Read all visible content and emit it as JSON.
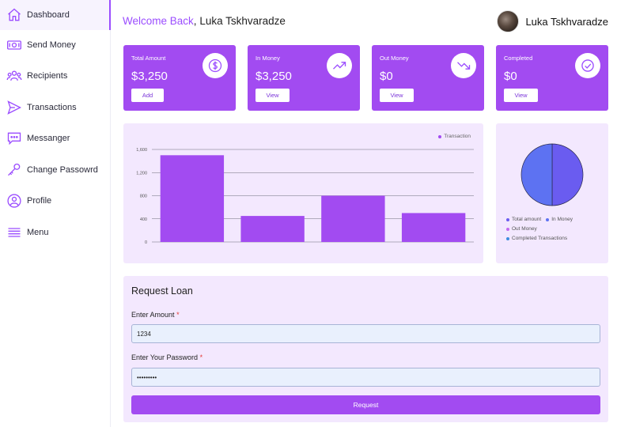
{
  "sidebar": {
    "items": [
      {
        "label": "Dashboard",
        "icon": "home-icon"
      },
      {
        "label": "Send Money",
        "icon": "money-icon"
      },
      {
        "label": "Recipients",
        "icon": "users-icon"
      },
      {
        "label": "Transactions",
        "icon": "send-icon"
      },
      {
        "label": "Messanger",
        "icon": "chat-icon"
      },
      {
        "label": "Change Passowrd",
        "icon": "key-icon"
      },
      {
        "label": "Profile",
        "icon": "profile-icon"
      },
      {
        "label": "Menu",
        "icon": "menu-icon"
      }
    ]
  },
  "header": {
    "welcome": "Welcome Back",
    "comma": ",",
    "user_name": "Luka Tskhvaradze"
  },
  "cards": [
    {
      "title": "Total Amount",
      "value": "$3,250",
      "button": "Add",
      "icon": "dollar-icon"
    },
    {
      "title": "In Money",
      "value": "$3,250",
      "button": "View",
      "icon": "trend-up-icon"
    },
    {
      "title": "Out Money",
      "value": "$0",
      "button": "View",
      "icon": "trend-down-icon"
    },
    {
      "title": "Completed",
      "value": "$0",
      "button": "View",
      "icon": "check-icon"
    }
  ],
  "colors": {
    "accent": "#a24bf1",
    "panel": "#f3e8fe",
    "bar": "#a24bf1",
    "pie_a": "#6a5cf0",
    "pie_b": "#5d72f2"
  },
  "chart_data": [
    {
      "type": "bar",
      "categories": [
        "",
        "",
        "",
        ""
      ],
      "series": [
        {
          "name": "Transaction",
          "values": [
            1500,
            450,
            800,
            500
          ]
        }
      ],
      "yticks": [
        "0",
        "400",
        "800",
        "1,200",
        "1,600"
      ],
      "ylim": [
        0,
        1600
      ],
      "grid": true,
      "legend": "top-right"
    },
    {
      "type": "pie",
      "labels": [
        "Total amount",
        "In Money",
        "Out Money",
        "Completed Transactions"
      ],
      "values": [
        3250,
        3250,
        0,
        0
      ],
      "legend": "bottom"
    }
  ],
  "loan": {
    "title": "Request Loan",
    "amount_label": "Enter Amount",
    "amount_value": "1234",
    "password_label": "Enter Your Password",
    "password_value": "•••••••••",
    "required_mark": "*",
    "submit": "Request"
  }
}
